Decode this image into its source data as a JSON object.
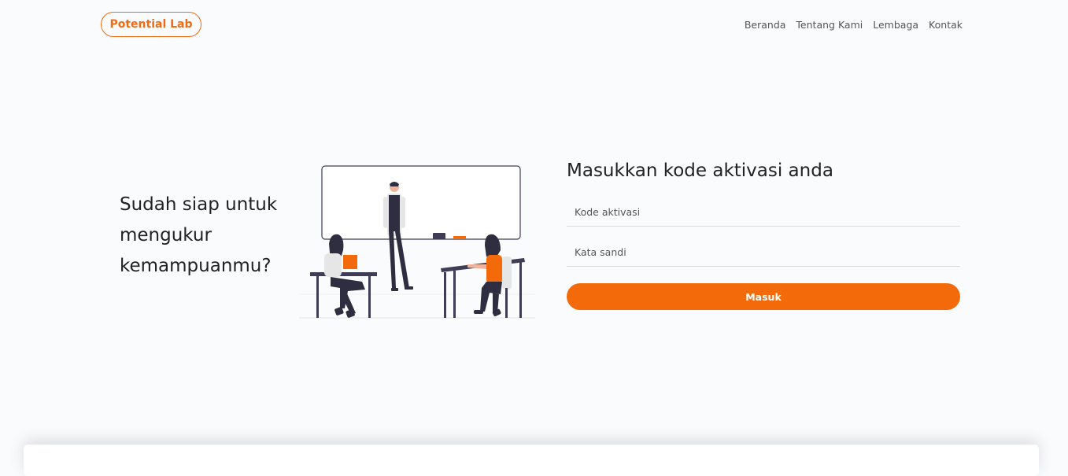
{
  "header": {
    "logo": "Potential Lab",
    "nav": [
      "Beranda",
      "Tentang Kami",
      "Lembaga",
      "Kontak"
    ]
  },
  "hero": {
    "line1": "Sudah siap untuk",
    "line2": "mengukur",
    "line3": "kemampuanmu?"
  },
  "form": {
    "title": "Masukkan kode aktivasi anda",
    "code_placeholder": "Kode aktivasi",
    "password_placeholder": "Kata sandi",
    "submit_label": "Masuk"
  },
  "colors": {
    "accent": "#f26a0a",
    "background": "#fafbfd"
  },
  "icons": {
    "illustration": "classroom-illustration"
  }
}
